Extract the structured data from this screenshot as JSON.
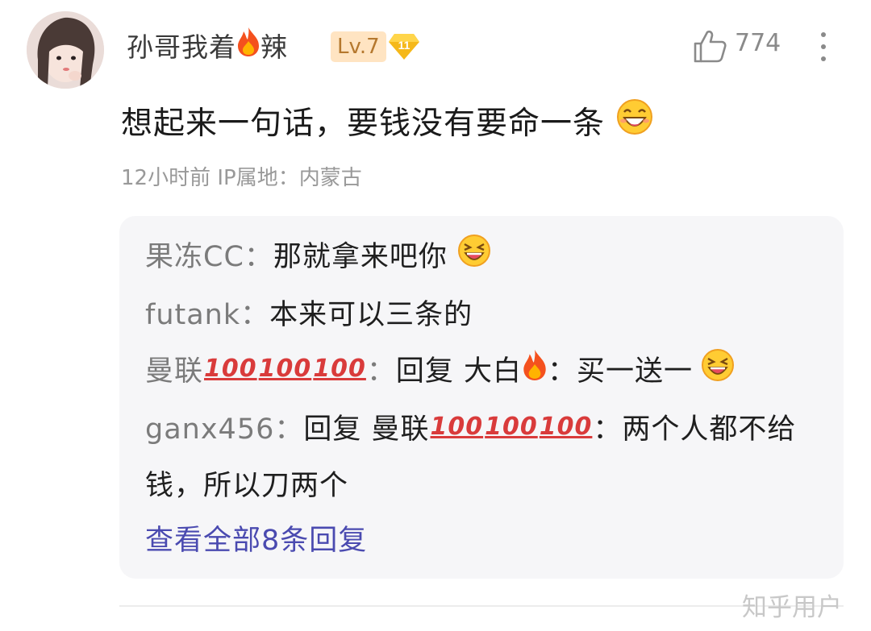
{
  "author": {
    "name_part1": "孙哥我着",
    "name_part2": "辣",
    "level": "Lv.7",
    "vip_badge": "11"
  },
  "like_count": "774",
  "comment_text": "想起来一句话，要钱没有要命一条",
  "meta": "12小时前  IP属地：内蒙古",
  "replies": [
    {
      "name": "果冻CC：",
      "text": "那就拿来吧你"
    },
    {
      "name": "futank：",
      "text": "本来可以三条的"
    },
    {
      "name": "曼联",
      "sep": "：",
      "text1": "回复 大白",
      "text2": " ：买一送一"
    },
    {
      "name": "ganx456：",
      "text1": "回复 曼联",
      "text2": " ：两个人都不给"
    },
    {
      "text": "钱，所以刀两个"
    }
  ],
  "view_all": "查看全部8条回复",
  "watermark": "知乎用户",
  "icons": {
    "hundred": "100",
    "fire": "fire-icon",
    "grin": "grin-emoji",
    "laugh": "laugh-emoji"
  },
  "colors": {
    "level_bg": "#ffe4c2",
    "level_text": "#b5782e",
    "vip": "#f5b81a",
    "link": "#4a4ab0",
    "reply_bg": "#f6f6f8"
  }
}
